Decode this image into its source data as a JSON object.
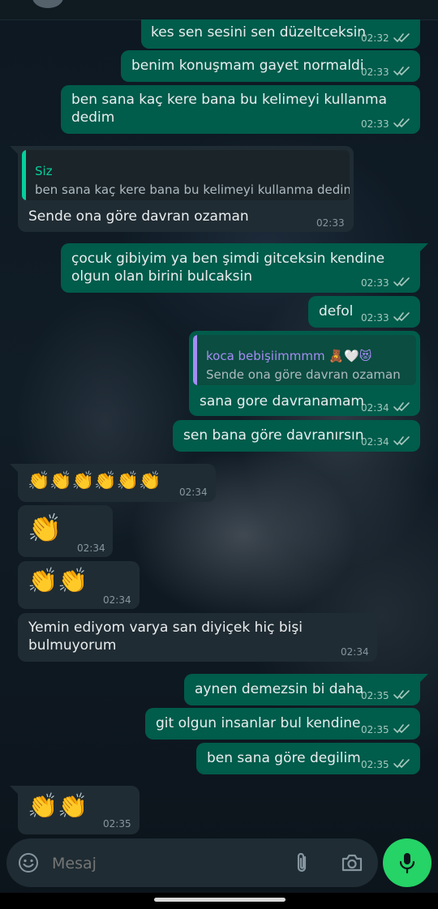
{
  "composer": {
    "placeholder": "Mesaj"
  },
  "messages": [
    {
      "text": "kes sen sesini sen düzeltceksin",
      "time": "02:32"
    },
    {
      "text": "benim konuşmam gayet normaldi",
      "time": "02:33"
    },
    {
      "line1": "ben sana kaç kere bana bu kelimeyi kullanma",
      "line2": "dedim",
      "time": "02:33"
    },
    {
      "quote_author": "Siz",
      "quote_text": "ben sana kaç kere bana bu kelimeyi kullanma dedim",
      "text": "Sende ona göre davran ozaman",
      "time": "02:33"
    },
    {
      "line1": "çocuk gibiyim ya ben şimdi gitceksin kendine",
      "line2": "olgun olan birini bulcaksin",
      "time": "02:33"
    },
    {
      "text": "defol",
      "time": "02:33"
    },
    {
      "quote_author": "koca bebişiimmmm 🧸🤍😻",
      "quote_text": "Sende ona göre davran ozaman",
      "text": "sana gore davranamam",
      "time": "02:34"
    },
    {
      "text": "sen bana göre davranırsın",
      "time": "02:34"
    },
    {
      "emoji": "👏👏👏👏👏👏",
      "time": "02:34"
    },
    {
      "emoji": "👏",
      "time": "02:34"
    },
    {
      "emoji": "👏👏",
      "time": "02:34"
    },
    {
      "line1": "Yemin ediyom varya san diyiçek hiç bişi",
      "line2": "bulmuyorum",
      "time": "02:34"
    },
    {
      "text": "aynen demezsin bi daha",
      "time": "02:35"
    },
    {
      "text": "git olgun insanlar bul kendine",
      "time": "02:35"
    },
    {
      "text": "ben sana göre degilim",
      "time": "02:35"
    },
    {
      "emoji": "👏👏",
      "time": "02:35"
    }
  ],
  "colors": {
    "outgoing_bubble": "#005c4b",
    "incoming_bubble": "#202c33",
    "accent": "#25d366",
    "read_ticks": "#a6c8be"
  },
  "icons": [
    "emoji-icon",
    "attach-icon",
    "camera-icon",
    "mic-icon",
    "double-check-icon"
  ]
}
